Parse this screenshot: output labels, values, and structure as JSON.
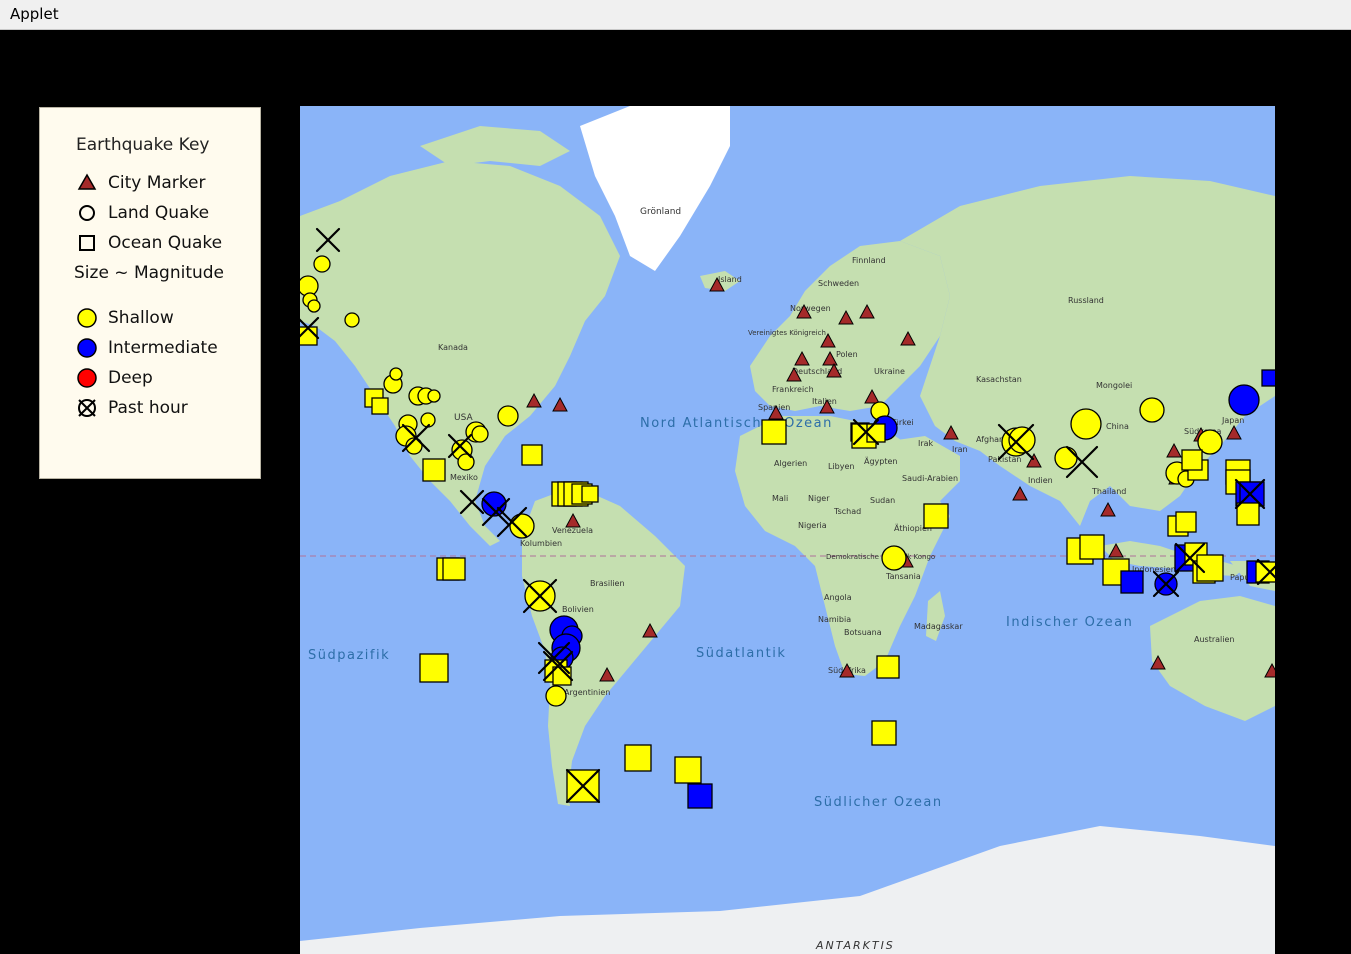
{
  "window": {
    "title": "Applet"
  },
  "key": {
    "title": "Earthquake Key",
    "city_marker": "City Marker",
    "land_quake": "Land Quake",
    "ocean_quake": "Ocean Quake",
    "size_note": "Size ~ Magnitude",
    "shallow": "Shallow",
    "intermediate": "Intermediate",
    "deep": "Deep",
    "past_hour": "Past hour"
  },
  "colors": {
    "shallow": "#ffff00",
    "intermediate": "#0000ff",
    "deep": "#ff0000",
    "city": "#a52a2a",
    "ocean": "#8ab4f8",
    "land": "#c7dfb0"
  },
  "map": {
    "labels": {
      "greenland": "Grönland",
      "iceland": "Island",
      "finland": "Finnland",
      "sweden": "Schweden",
      "norway": "Norwegen",
      "russia": "Russland",
      "uk": "Vereinigtes Königreich",
      "poland": "Polen",
      "germany": "Deutschland",
      "ukraine": "Ukraine",
      "france": "Frankreich",
      "italy": "Italien",
      "spain": "Spanien",
      "kazakhstan": "Kasachstan",
      "mongolia": "Mongolei",
      "turkey": "Türkei",
      "china": "China",
      "japan": "Japan",
      "south_korea": "Südkorea",
      "iran": "Iran",
      "iraq": "Irak",
      "afghanistan": "Afghanistan",
      "pakistan": "Pakistan",
      "india": "Indien",
      "thailand": "Thailand",
      "canada": "Kanada",
      "usa": "USA",
      "mexico": "Mexiko",
      "venezuela": "Venezuela",
      "colombia": "Kolumbien",
      "brazil": "Brasilien",
      "bolivia": "Bolivien",
      "argentina": "Argentinien",
      "algeria": "Algerien",
      "libya": "Libyen",
      "egypt": "Ägypten",
      "saudi": "Saudi-Arabien",
      "mali": "Mali",
      "niger": "Niger",
      "chad": "Tschad",
      "sudan": "Sudan",
      "nigeria": "Nigeria",
      "ethiopia": "Äthiopien",
      "drc": "Demokratische Republik Kongo",
      "tanzania": "Tansania",
      "angola": "Angola",
      "namibia": "Namibia",
      "botswana": "Botsuana",
      "madagascar": "Madagaskar",
      "south_africa": "Südafrika",
      "indonesia": "Indonesien",
      "papua": "Papua-Neuguinea",
      "australia": "Australien",
      "north_atlantic": "Nord Atlantischer Ozean",
      "south_pacific": "Südpazifik",
      "south_atlantic": "Südatlantik",
      "indian_ocean": "Indischer Ozean",
      "southern_ocean": "Südlicher Ozean",
      "antarctica": "ANTARKTIS"
    }
  }
}
